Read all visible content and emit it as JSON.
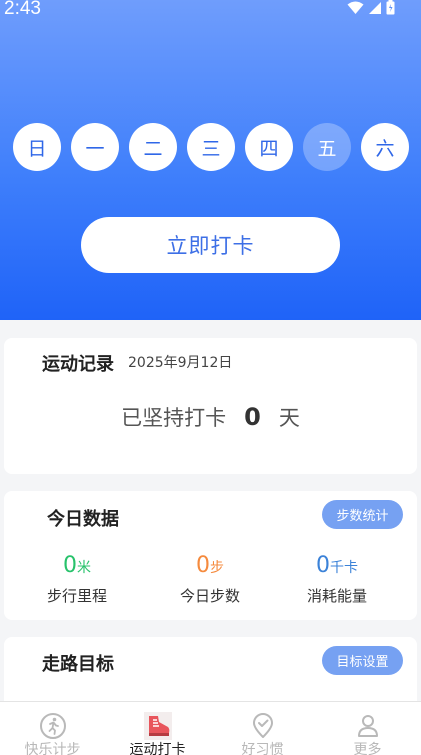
{
  "status_bar": {
    "time": "2:43"
  },
  "week": {
    "days": [
      "日",
      "一",
      "二",
      "三",
      "四",
      "五",
      "六"
    ],
    "selected_index": 5
  },
  "punch_button": {
    "label": "立即打卡"
  },
  "record_card": {
    "title": "运动记录",
    "date": "2025年9月12日",
    "persist_prefix": "已坚持打卡",
    "persist_days": "0",
    "persist_suffix": "天"
  },
  "today_card": {
    "title": "今日数据",
    "stats_button": "步数统计",
    "stats": [
      {
        "value": "0",
        "unit": "米",
        "label": "步行里程"
      },
      {
        "value": "0",
        "unit": "步",
        "label": "今日步数"
      },
      {
        "value": "0",
        "unit": "千卡",
        "label": "消耗能量"
      }
    ]
  },
  "goal_card": {
    "title": "走路目标",
    "settings_button": "目标设置"
  },
  "tabbar": {
    "active_index": 1,
    "tabs": [
      {
        "label": "快乐计步",
        "icon": "running-icon"
      },
      {
        "label": "运动打卡",
        "icon": "sneaker-icon"
      },
      {
        "label": "好习惯",
        "icon": "check-pin-icon"
      },
      {
        "label": "更多",
        "icon": "user-icon"
      }
    ]
  },
  "colors": {
    "hero_top": "#6f9dfc",
    "hero_bottom": "#1f63f8",
    "accent": "#3d6fe6",
    "pill": "#76a1f2",
    "distance": "#27c26b",
    "steps": "#f58a3d",
    "calories": "#3b82d8"
  }
}
